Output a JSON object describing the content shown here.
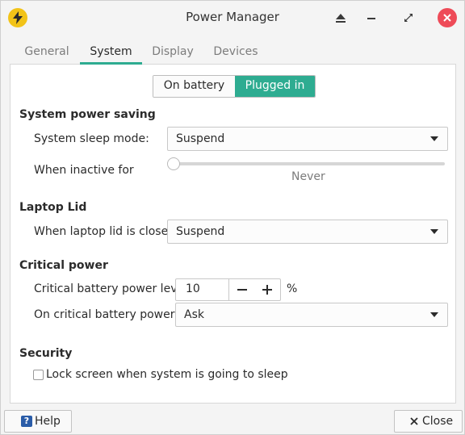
{
  "window": {
    "title": "Power Manager"
  },
  "tabs": [
    {
      "label": "General"
    },
    {
      "label": "System"
    },
    {
      "label": "Display"
    },
    {
      "label": "Devices"
    }
  ],
  "power_source": {
    "options": [
      "On battery",
      "Plugged in"
    ],
    "selected": "Plugged in"
  },
  "system_power_saving": {
    "heading": "System power saving",
    "sleep_mode_label": "System sleep mode:",
    "sleep_mode_value": "Suspend",
    "inactive_label": "When inactive for",
    "inactive_value": "Never",
    "inactive_level": 0
  },
  "laptop_lid": {
    "heading": "Laptop Lid",
    "lid_closed_label": "When laptop lid is closed:",
    "lid_closed_value": "Suspend"
  },
  "critical_power": {
    "heading": "Critical power",
    "level_label": "Critical battery power level:",
    "level_value": "10",
    "level_unit": "%",
    "action_label": "On critical battery power:",
    "action_value": "Ask"
  },
  "security": {
    "heading": "Security",
    "lock_label": "Lock screen when system is going to sleep",
    "lock_checked": false
  },
  "footer": {
    "help_label": "Help",
    "close_label": "Close"
  },
  "colors": {
    "accent": "#2eac91",
    "close_button": "#ee4b58",
    "app_icon": "#f2c318",
    "help_icon": "#2a5ca8"
  }
}
